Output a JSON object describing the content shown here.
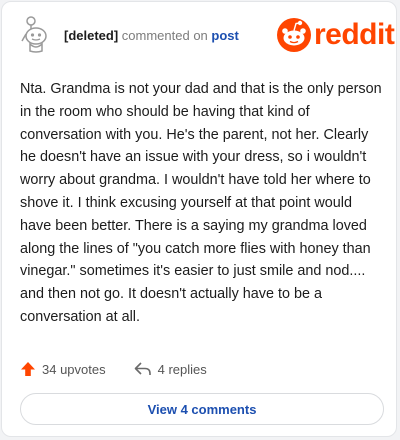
{
  "comment": {
    "author": "[deleted]",
    "commented_on_text": "commented on",
    "post_link": "post",
    "body": "Nta. Grandma is not your dad and that is the only person in the room who should be having that kind of conversation with you. He's the parent, not her. Clearly he doesn't have an issue with your dress, so i wouldn't worry about grandma. I wouldn't have told her where to shove it. I think excusing yourself at that point would have been better. There is a saying my grandma loved along the lines of \"you catch more flies with honey than vinegar.\" sometimes it's easier to just smile and nod.... and then not go. It doesn't actually have to be a conversation at all."
  },
  "brand": {
    "name": "reddit",
    "color": "#ff4500"
  },
  "actions": {
    "upvotes": "34 upvotes",
    "replies": "4 replies"
  },
  "view_comments_label": "View 4 comments",
  "icons": {
    "avatar": "snoo-avatar-icon",
    "logo": "reddit-snoo-icon",
    "upvote": "upvote-arrow-icon",
    "reply": "reply-arrow-icon"
  }
}
